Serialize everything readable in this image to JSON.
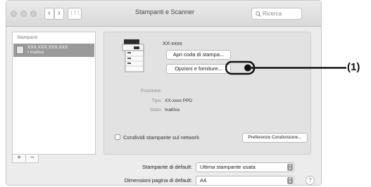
{
  "window": {
    "title": "Stampanti e Scanner",
    "search_placeholder": "Ricerca"
  },
  "toolbar": {
    "back_glyph": "‹",
    "forward_glyph": "›",
    "grid_glyph": "⋮⋮⋮"
  },
  "sidebar": {
    "header": "Stampanti",
    "printers": [
      {
        "name": "XXX.XXX.XXX.XXX",
        "status": "• Inattiva"
      }
    ],
    "add_label": "+",
    "remove_label": "−"
  },
  "detail": {
    "printer_name": "XX-xxxx",
    "open_queue_label": "Apri coda di stampa...",
    "options_label": "Opzioni e forniture...",
    "fields": [
      {
        "label": "Posizione:",
        "value": ""
      },
      {
        "label": "Tipo:",
        "value": "XX-xxxx PPD"
      },
      {
        "label": "Stato:",
        "value": "Inattiva"
      }
    ],
    "share_label": "Condividi stampante sul network",
    "share_checked": false,
    "sharing_prefs_label": "Preferenze Condivisione..."
  },
  "defaults": {
    "default_printer_label": "Stampante di default:",
    "default_printer_value": "Ultima stampante usata",
    "paper_size_label": "Dimensioni pagina di default:",
    "paper_size_value": "A4",
    "help_glyph": "?"
  },
  "callout": {
    "label": "(1)"
  },
  "colors": {
    "callout": "#111111",
    "selection": "#9a9a9a"
  },
  "icons": [
    "back-icon",
    "forward-icon",
    "grid-icon",
    "search-icon",
    "printer-icon",
    "help-icon"
  ]
}
